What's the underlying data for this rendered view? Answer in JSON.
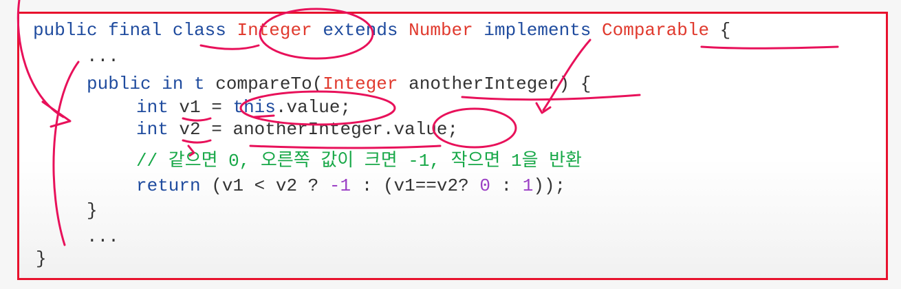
{
  "code": {
    "line1": {
      "kw_public": "public",
      "kw_final": "final",
      "kw_class": "class",
      "type_integer": "Integer",
      "kw_extends": "extends",
      "type_number": "Number",
      "kw_implements": "implements",
      "type_comparable": "Comparable",
      "brace": "{"
    },
    "line2": {
      "text": "..."
    },
    "line3": {
      "kw_public": "public",
      "kw_int": "in t",
      "method": "compareTo(",
      "type_integer": "Integer",
      "param": "anotherInteger) {"
    },
    "line4": {
      "kw_int": "int",
      "var": "v1",
      "eq": "=",
      "kw_this": "this",
      "rest": ".value;"
    },
    "line5": {
      "kw_int": "int",
      "var": "v2",
      "eq": "=",
      "rest": "anotherInteger.value;"
    },
    "line6": {
      "comment": "// 같으면 0, 오른쪽 값이 크면 -1, 작으면 1을 반환"
    },
    "line7": {
      "kw_return": "return",
      "p1": "(v1 < v2 ? ",
      "n1": "-1",
      "p2": " : (v1==v2? ",
      "n2": "0",
      "p3": " : ",
      "n3": "1",
      "p4": "));"
    },
    "line8": {
      "text": "}"
    },
    "line9": {
      "text": "..."
    },
    "line10": {
      "text": "}"
    }
  },
  "colors": {
    "keyword": "#1f4b9e",
    "type": "#e03a2e",
    "comment": "#18a848",
    "number": "#9b3fc5",
    "ink": "#e8115a",
    "frame": "#e8112d"
  }
}
